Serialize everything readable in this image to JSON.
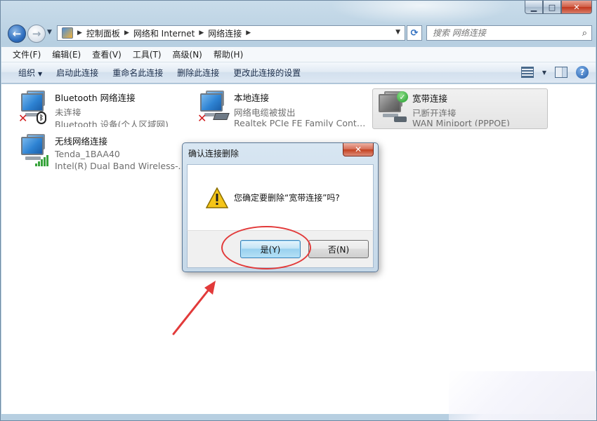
{
  "address": {
    "crumbs": [
      "控制面板",
      "网络和 Internet",
      "网络连接"
    ]
  },
  "search": {
    "placeholder": "搜索 网络连接"
  },
  "menu": [
    "文件(F)",
    "编辑(E)",
    "查看(V)",
    "工具(T)",
    "高级(N)",
    "帮助(H)"
  ],
  "commands": {
    "organize": "组织",
    "enable": "启动此连接",
    "rename": "重命名此连接",
    "delete": "删除此连接",
    "settings": "更改此连接的设置"
  },
  "connections": [
    {
      "name": "Bluetooth 网络连接",
      "status": "未连接",
      "device": "Bluetooth 设备(个人区域网)"
    },
    {
      "name": "本地连接",
      "status": "网络电缆被拔出",
      "device": "Realtek PCIe FE Family Control..."
    },
    {
      "name": "宽带连接",
      "status": "已断开连接",
      "device": "WAN Miniport (PPPOE)"
    },
    {
      "name": "无线网络连接",
      "status": "Tenda_1BAA40",
      "device": "Intel(R) Dual Band Wireless-A..."
    }
  ],
  "dialog": {
    "title": "确认连接删除",
    "message": "您确定要删除“宽带连接”吗?",
    "yes": "是(Y)",
    "no": "否(N)"
  },
  "colors": {
    "annotation": "#e23a3a",
    "selection": "#e4e4e4",
    "accent": "#2f6fc0"
  }
}
